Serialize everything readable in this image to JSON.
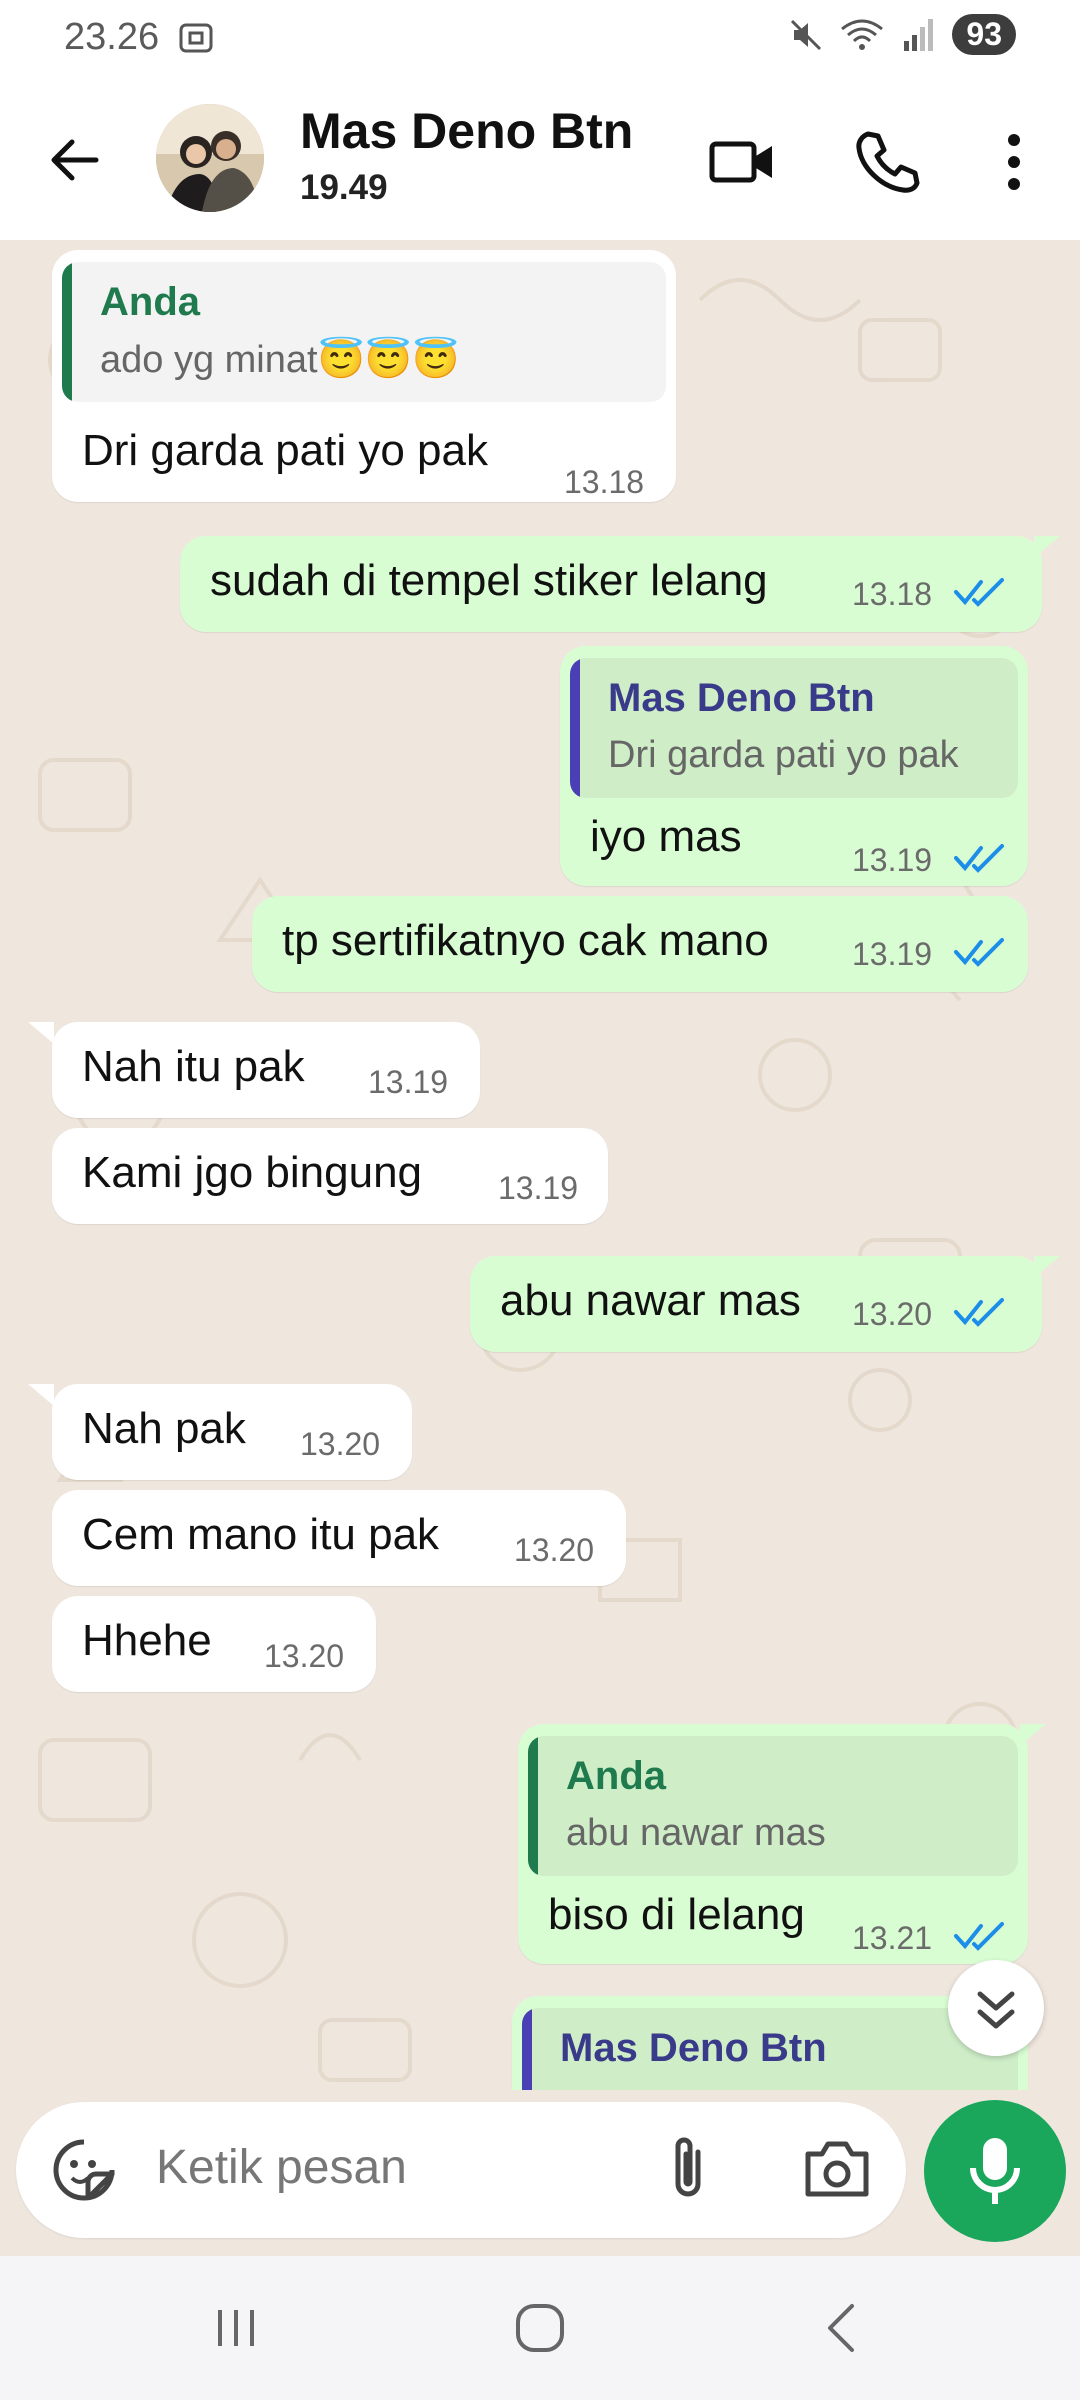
{
  "status_bar": {
    "time": "23.26",
    "battery": "93"
  },
  "header": {
    "contact_name": "Mas Deno Btn",
    "last_seen": "19.49"
  },
  "messages": [
    {
      "dir": "in",
      "quote_name": "Anda",
      "quote_text": "ado yg minat😇😇😇",
      "text": "Dri garda pati yo pak",
      "time": "13.18"
    },
    {
      "dir": "out",
      "text": "sudah di tempel stiker lelang",
      "time": "13.18"
    },
    {
      "dir": "out",
      "quote_name": "Mas Deno Btn",
      "quote_text": "Dri garda pati yo pak",
      "text": "iyo mas",
      "time": "13.19"
    },
    {
      "dir": "out",
      "text": "tp sertifikatnyo cak mano",
      "time": "13.19"
    },
    {
      "dir": "in",
      "text": "Nah itu pak",
      "time": "13.19"
    },
    {
      "dir": "in",
      "text": "Kami jgo bingung",
      "time": "13.19"
    },
    {
      "dir": "out",
      "text": "abu nawar mas",
      "time": "13.20"
    },
    {
      "dir": "in",
      "text": "Nah pak",
      "time": "13.20"
    },
    {
      "dir": "in",
      "text": "Cem mano itu pak",
      "time": "13.20"
    },
    {
      "dir": "in",
      "text": "Hhehe",
      "time": "13.20"
    },
    {
      "dir": "out",
      "quote_name": "Anda",
      "quote_text": "abu nawar mas",
      "text": "biso di lelang",
      "time": "13.21"
    },
    {
      "dir": "out",
      "quote_name": "Mas Deno Btn",
      "quote_text": "",
      "text": "",
      "time": ""
    }
  ],
  "input": {
    "placeholder": "Ketik pesan"
  },
  "colors": {
    "accent_green": "#1aa65b",
    "tick_blue": "#1c8ee8",
    "quote_you": "#1f7a4d",
    "quote_other": "#4a3fb5"
  }
}
